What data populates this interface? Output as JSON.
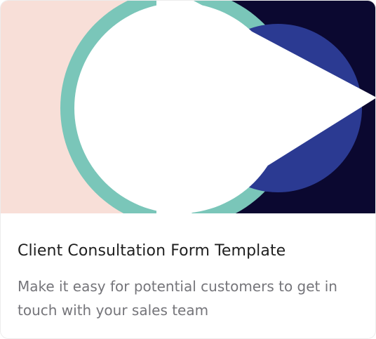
{
  "card": {
    "title": "Client Consultation Form Template",
    "description": "Make it easy for potential customers to get in touch with your sales team"
  },
  "hero": {
    "colors": {
      "peach": "#f8dfd8",
      "navy": "#0b0830",
      "teal": "#7ac6b9",
      "blue": "#2b3a92",
      "white": "#ffffff"
    }
  }
}
